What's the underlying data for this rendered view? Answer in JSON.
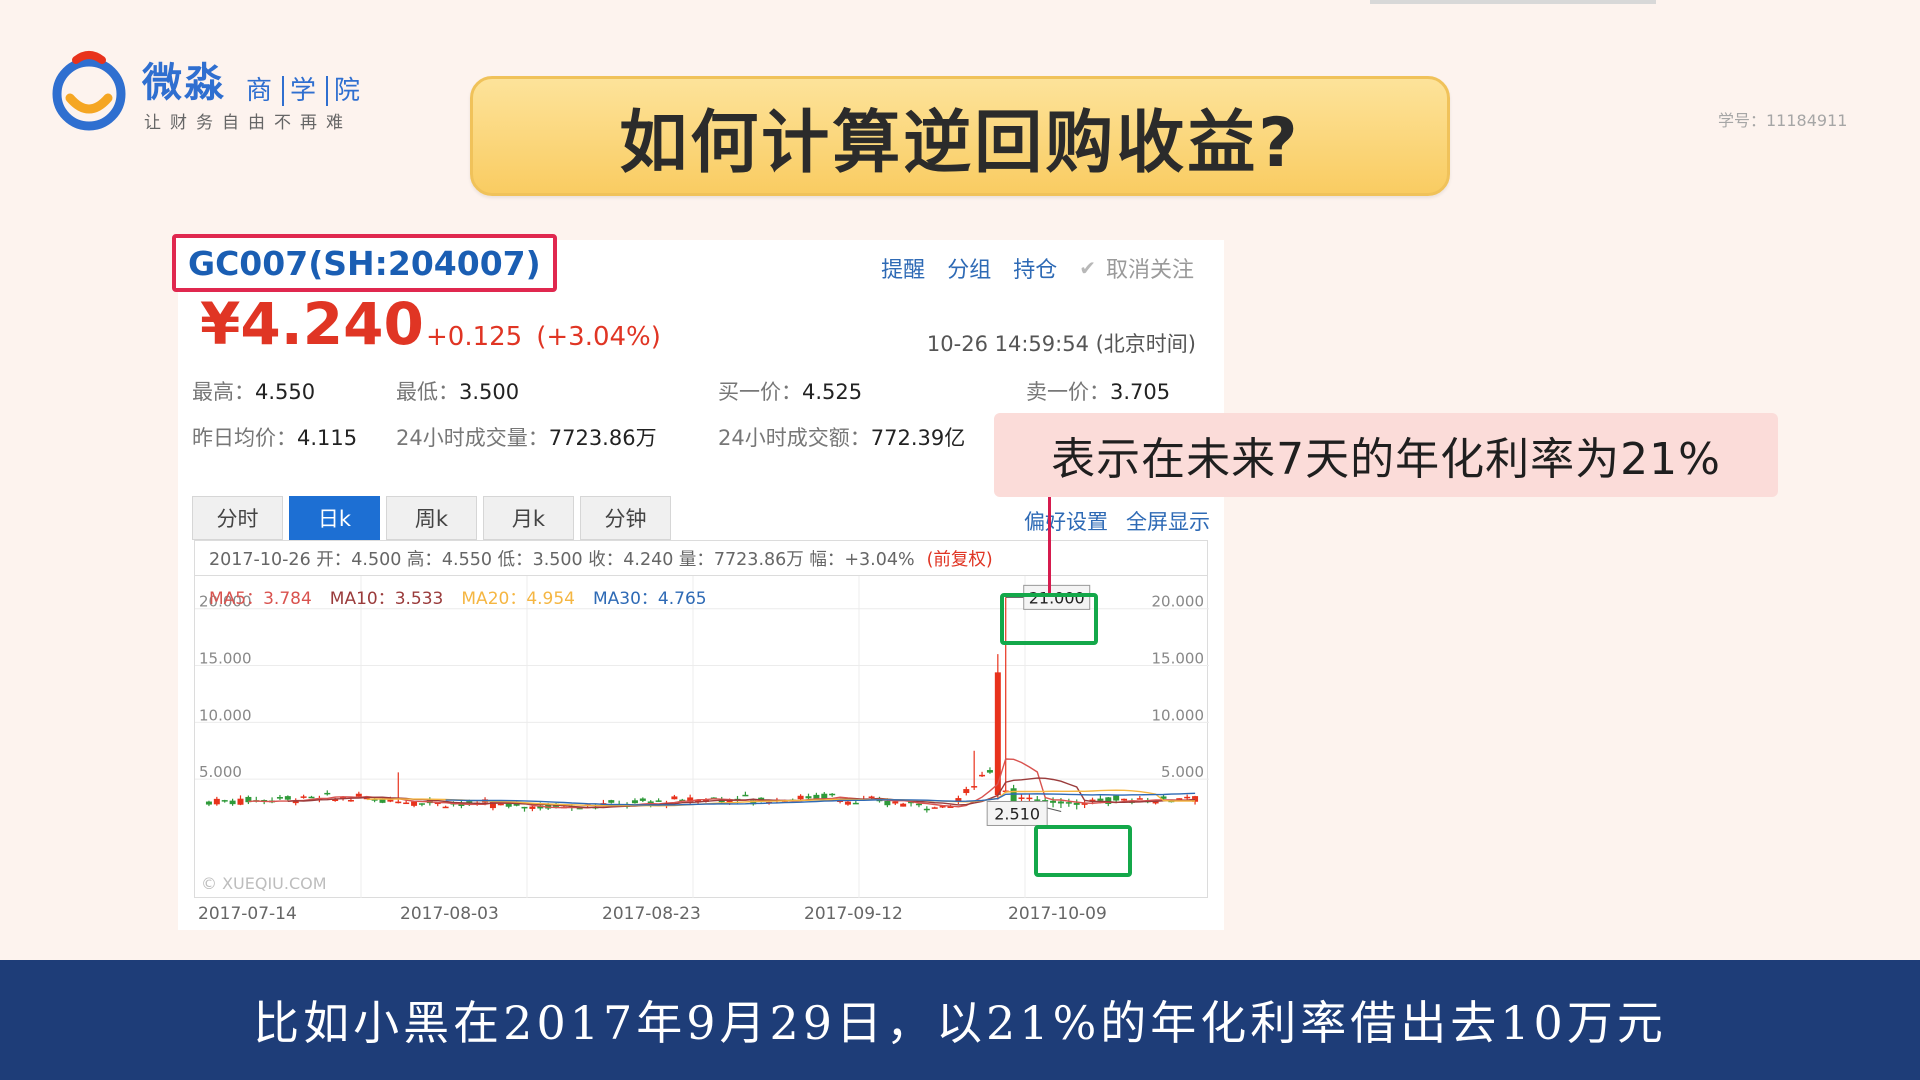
{
  "logo": {
    "name": "微淼",
    "sub": [
      "商",
      "学",
      "院"
    ],
    "slogan": "让财务自由不再难"
  },
  "title": "如何计算逆回购收益?",
  "student_id": "学号：11184911",
  "quote": {
    "ticker": "GC007(SH:204007)",
    "actions": {
      "remind": "提醒",
      "group": "分组",
      "hold": "持仓",
      "unfollow": "取消关注"
    },
    "price": "¥4.240",
    "change": "+0.125",
    "change_pct": "(+3.04%)",
    "timestamp": "10-26 14:59:54 (北京时间)",
    "stats": {
      "high": {
        "label": "最高：",
        "value": "4.550"
      },
      "low": {
        "label": "最低：",
        "value": "3.500"
      },
      "bid": {
        "label": "买一价：",
        "value": "4.525"
      },
      "ask": {
        "label": "卖一价：",
        "value": "3.705"
      },
      "prev_avg": {
        "label": "昨日均价：",
        "value": "4.115"
      },
      "volume": {
        "label": "24小时成交量：",
        "value": "7723.86万"
      },
      "turnover": {
        "label": "24小时成交额：",
        "value": "772.39亿"
      }
    }
  },
  "tabs": [
    "分时",
    "日k",
    "周k",
    "月k",
    "分钟"
  ],
  "active_tab": 1,
  "chart_links": {
    "prefs": "偏好设置",
    "fullscreen": "全屏显示"
  },
  "ohlc": {
    "text": "2017-10-26 开：4.500 高：4.550 低：3.500 收：4.240 量：7723.86万 幅：+3.04%",
    "adjust": "(前复权)"
  },
  "ma": [
    {
      "label": "MA5：3.784",
      "color": "#d9534f"
    },
    {
      "label": "MA10：3.533",
      "color": "#9a3b3b"
    },
    {
      "label": "MA20：4.954",
      "color": "#f5b642"
    },
    {
      "label": "MA30：4.765",
      "color": "#2e6ab5"
    }
  ],
  "watermark": "© XUEQIU.COM",
  "chart_data": {
    "type": "candlestick",
    "x_ticks": [
      "2017-07-14",
      "2017-08-03",
      "2017-08-23",
      "2017-09-12",
      "2017-10-09"
    ],
    "y_ticks": [
      "20.000",
      "15.000",
      "10.000",
      "5.000"
    ],
    "ylim": [
      0,
      22
    ],
    "annotations": {
      "max": "21.000",
      "min": "2.510"
    },
    "grid": true,
    "colors": {
      "up": "#e8321c",
      "down": "#2f9a3a"
    }
  },
  "callout": "表示在未来7天的年化利率为21%",
  "subtitle": "比如小黑在2017年9月29日，以21%的年化利率借出去10万元"
}
